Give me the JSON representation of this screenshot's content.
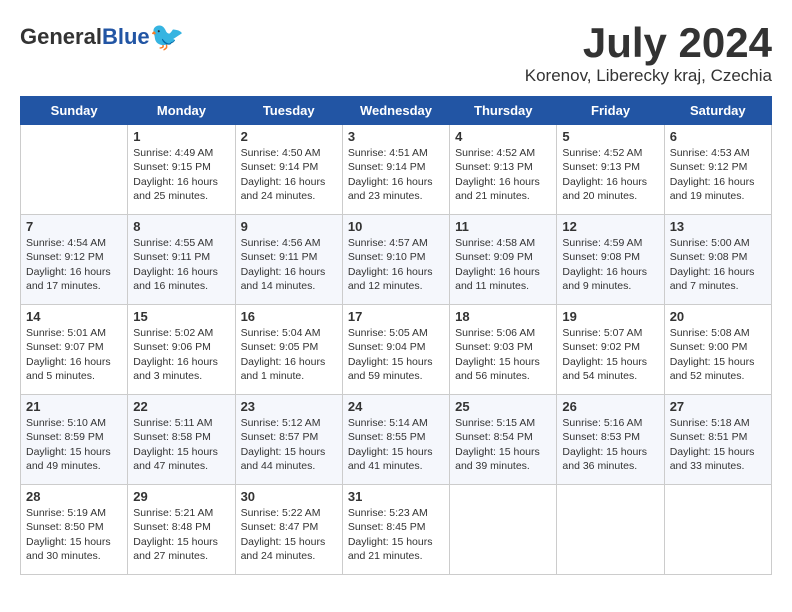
{
  "header": {
    "logo_general": "General",
    "logo_blue": "Blue",
    "title": "July 2024",
    "subtitle": "Korenov, Liberecky kraj, Czechia"
  },
  "weekdays": [
    "Sunday",
    "Monday",
    "Tuesday",
    "Wednesday",
    "Thursday",
    "Friday",
    "Saturday"
  ],
  "weeks": [
    [
      {
        "day": "",
        "info": ""
      },
      {
        "day": "1",
        "info": "Sunrise: 4:49 AM\nSunset: 9:15 PM\nDaylight: 16 hours\nand 25 minutes."
      },
      {
        "day": "2",
        "info": "Sunrise: 4:50 AM\nSunset: 9:14 PM\nDaylight: 16 hours\nand 24 minutes."
      },
      {
        "day": "3",
        "info": "Sunrise: 4:51 AM\nSunset: 9:14 PM\nDaylight: 16 hours\nand 23 minutes."
      },
      {
        "day": "4",
        "info": "Sunrise: 4:52 AM\nSunset: 9:13 PM\nDaylight: 16 hours\nand 21 minutes."
      },
      {
        "day": "5",
        "info": "Sunrise: 4:52 AM\nSunset: 9:13 PM\nDaylight: 16 hours\nand 20 minutes."
      },
      {
        "day": "6",
        "info": "Sunrise: 4:53 AM\nSunset: 9:12 PM\nDaylight: 16 hours\nand 19 minutes."
      }
    ],
    [
      {
        "day": "7",
        "info": "Sunrise: 4:54 AM\nSunset: 9:12 PM\nDaylight: 16 hours\nand 17 minutes."
      },
      {
        "day": "8",
        "info": "Sunrise: 4:55 AM\nSunset: 9:11 PM\nDaylight: 16 hours\nand 16 minutes."
      },
      {
        "day": "9",
        "info": "Sunrise: 4:56 AM\nSunset: 9:11 PM\nDaylight: 16 hours\nand 14 minutes."
      },
      {
        "day": "10",
        "info": "Sunrise: 4:57 AM\nSunset: 9:10 PM\nDaylight: 16 hours\nand 12 minutes."
      },
      {
        "day": "11",
        "info": "Sunrise: 4:58 AM\nSunset: 9:09 PM\nDaylight: 16 hours\nand 11 minutes."
      },
      {
        "day": "12",
        "info": "Sunrise: 4:59 AM\nSunset: 9:08 PM\nDaylight: 16 hours\nand 9 minutes."
      },
      {
        "day": "13",
        "info": "Sunrise: 5:00 AM\nSunset: 9:08 PM\nDaylight: 16 hours\nand 7 minutes."
      }
    ],
    [
      {
        "day": "14",
        "info": "Sunrise: 5:01 AM\nSunset: 9:07 PM\nDaylight: 16 hours\nand 5 minutes."
      },
      {
        "day": "15",
        "info": "Sunrise: 5:02 AM\nSunset: 9:06 PM\nDaylight: 16 hours\nand 3 minutes."
      },
      {
        "day": "16",
        "info": "Sunrise: 5:04 AM\nSunset: 9:05 PM\nDaylight: 16 hours\nand 1 minute."
      },
      {
        "day": "17",
        "info": "Sunrise: 5:05 AM\nSunset: 9:04 PM\nDaylight: 15 hours\nand 59 minutes."
      },
      {
        "day": "18",
        "info": "Sunrise: 5:06 AM\nSunset: 9:03 PM\nDaylight: 15 hours\nand 56 minutes."
      },
      {
        "day": "19",
        "info": "Sunrise: 5:07 AM\nSunset: 9:02 PM\nDaylight: 15 hours\nand 54 minutes."
      },
      {
        "day": "20",
        "info": "Sunrise: 5:08 AM\nSunset: 9:00 PM\nDaylight: 15 hours\nand 52 minutes."
      }
    ],
    [
      {
        "day": "21",
        "info": "Sunrise: 5:10 AM\nSunset: 8:59 PM\nDaylight: 15 hours\nand 49 minutes."
      },
      {
        "day": "22",
        "info": "Sunrise: 5:11 AM\nSunset: 8:58 PM\nDaylight: 15 hours\nand 47 minutes."
      },
      {
        "day": "23",
        "info": "Sunrise: 5:12 AM\nSunset: 8:57 PM\nDaylight: 15 hours\nand 44 minutes."
      },
      {
        "day": "24",
        "info": "Sunrise: 5:14 AM\nSunset: 8:55 PM\nDaylight: 15 hours\nand 41 minutes."
      },
      {
        "day": "25",
        "info": "Sunrise: 5:15 AM\nSunset: 8:54 PM\nDaylight: 15 hours\nand 39 minutes."
      },
      {
        "day": "26",
        "info": "Sunrise: 5:16 AM\nSunset: 8:53 PM\nDaylight: 15 hours\nand 36 minutes."
      },
      {
        "day": "27",
        "info": "Sunrise: 5:18 AM\nSunset: 8:51 PM\nDaylight: 15 hours\nand 33 minutes."
      }
    ],
    [
      {
        "day": "28",
        "info": "Sunrise: 5:19 AM\nSunset: 8:50 PM\nDaylight: 15 hours\nand 30 minutes."
      },
      {
        "day": "29",
        "info": "Sunrise: 5:21 AM\nSunset: 8:48 PM\nDaylight: 15 hours\nand 27 minutes."
      },
      {
        "day": "30",
        "info": "Sunrise: 5:22 AM\nSunset: 8:47 PM\nDaylight: 15 hours\nand 24 minutes."
      },
      {
        "day": "31",
        "info": "Sunrise: 5:23 AM\nSunset: 8:45 PM\nDaylight: 15 hours\nand 21 minutes."
      },
      {
        "day": "",
        "info": ""
      },
      {
        "day": "",
        "info": ""
      },
      {
        "day": "",
        "info": ""
      }
    ]
  ]
}
